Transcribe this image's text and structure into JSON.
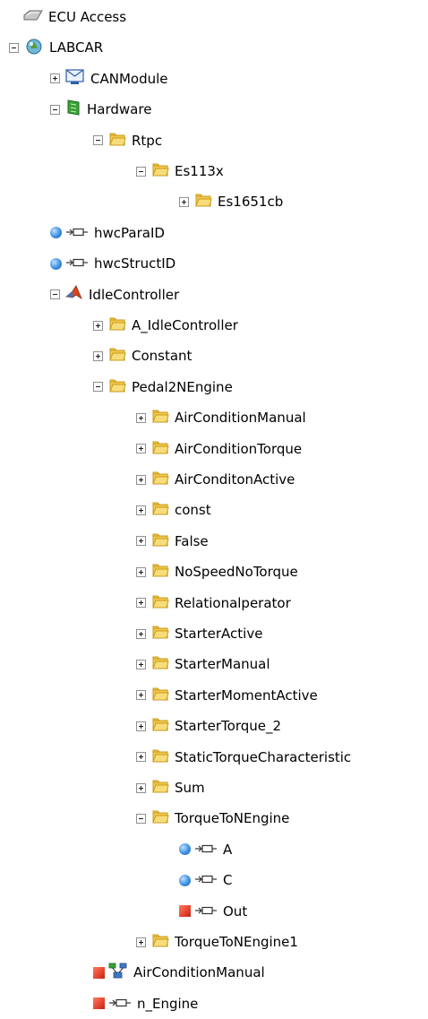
{
  "tree": {
    "nodes": [
      {
        "label": "ECU Access",
        "level": 0,
        "expander": "none",
        "icon": "ecu-access-icon"
      },
      {
        "label": "LABCAR",
        "level": 0,
        "expander": "minus",
        "icon": "labcar-icon"
      },
      {
        "label": "CANModule",
        "level": 1,
        "expander": "plus",
        "icon": "can-module-icon"
      },
      {
        "label": "Hardware",
        "level": 1,
        "expander": "minus",
        "icon": "hardware-board-icon"
      },
      {
        "label": "Rtpc",
        "level": 2,
        "expander": "minus",
        "icon": "folder-icon"
      },
      {
        "label": "Es113x",
        "level": 3,
        "expander": "minus",
        "icon": "folder-icon"
      },
      {
        "label": "Es1651cb",
        "level": 4,
        "expander": "plus",
        "icon": "folder-icon"
      },
      {
        "label": "hwcParaID",
        "level": 1,
        "expander": "none",
        "icon": "input-port-icon",
        "marker": "blue-dot"
      },
      {
        "label": "hwcStructID",
        "level": 1,
        "expander": "none",
        "icon": "input-port-icon",
        "marker": "blue-dot"
      },
      {
        "label": "IdleController",
        "level": 1,
        "expander": "minus",
        "icon": "matlab-model-icon"
      },
      {
        "label": "A_IdleController",
        "level": 2,
        "expander": "plus",
        "icon": "folder-icon"
      },
      {
        "label": "Constant",
        "level": 2,
        "expander": "plus",
        "icon": "folder-icon"
      },
      {
        "label": "Pedal2NEngine",
        "level": 2,
        "expander": "minus",
        "icon": "folder-icon"
      },
      {
        "label": "AirConditionManual",
        "level": 3,
        "expander": "plus",
        "icon": "folder-icon"
      },
      {
        "label": "AirConditionTorque",
        "level": 3,
        "expander": "plus",
        "icon": "folder-icon"
      },
      {
        "label": "AirConditonActive",
        "level": 3,
        "expander": "plus",
        "icon": "folder-icon"
      },
      {
        "label": "const",
        "level": 3,
        "expander": "plus",
        "icon": "folder-icon"
      },
      {
        "label": "False",
        "level": 3,
        "expander": "plus",
        "icon": "folder-icon"
      },
      {
        "label": "NoSpeedNoTorque",
        "level": 3,
        "expander": "plus",
        "icon": "folder-icon"
      },
      {
        "label": "Relationalperator",
        "level": 3,
        "expander": "plus",
        "icon": "folder-icon"
      },
      {
        "label": "StarterActive",
        "level": 3,
        "expander": "plus",
        "icon": "folder-icon"
      },
      {
        "label": "StarterManual",
        "level": 3,
        "expander": "plus",
        "icon": "folder-icon"
      },
      {
        "label": "StarterMomentActive",
        "level": 3,
        "expander": "plus",
        "icon": "folder-icon"
      },
      {
        "label": "StarterTorque_2",
        "level": 3,
        "expander": "plus",
        "icon": "folder-icon"
      },
      {
        "label": "StaticTorqueCharacteristic",
        "level": 3,
        "expander": "plus",
        "icon": "folder-icon"
      },
      {
        "label": "Sum",
        "level": 3,
        "expander": "plus",
        "icon": "folder-icon"
      },
      {
        "label": "TorqueToNEngine",
        "level": 3,
        "expander": "minus",
        "icon": "folder-icon"
      },
      {
        "label": "A",
        "level": 4,
        "expander": "none",
        "icon": "input-port-icon",
        "marker": "blue-dot"
      },
      {
        "label": "C",
        "level": 4,
        "expander": "none",
        "icon": "input-port-icon",
        "marker": "blue-dot"
      },
      {
        "label": "Out",
        "level": 4,
        "expander": "none",
        "icon": "output-port-icon",
        "marker": "red-square"
      },
      {
        "label": "TorqueToNEngine1",
        "level": 3,
        "expander": "plus",
        "icon": "folder-icon"
      },
      {
        "label": "AirConditionManual",
        "level": 2,
        "expander": "none",
        "icon": "signal-network-icon",
        "marker": "red-square"
      },
      {
        "label": "n_Engine",
        "level": 2,
        "expander": "none",
        "icon": "output-port-icon",
        "marker": "red-square"
      }
    ]
  },
  "colors": {
    "folder": "#f2c94c",
    "folder_edge": "#c99a1c",
    "blue_marker": "#3b8fe0",
    "red_marker": "#e5432f",
    "port_stroke": "#333333"
  }
}
